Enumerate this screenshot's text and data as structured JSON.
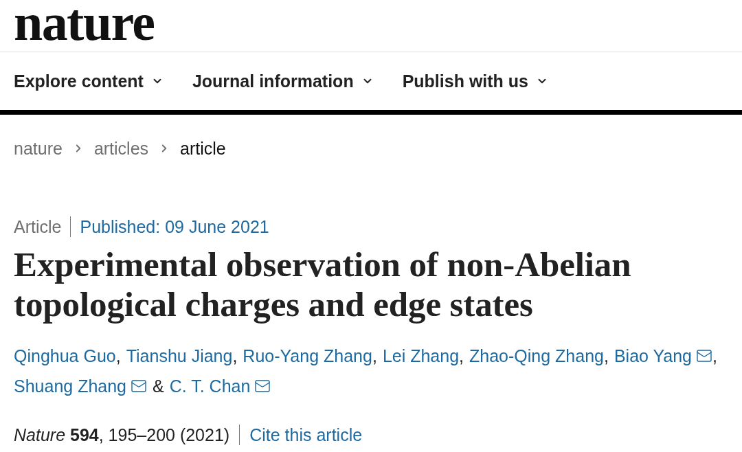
{
  "header": {
    "logo": "nature"
  },
  "nav": [
    {
      "label": "Explore content"
    },
    {
      "label": "Journal information"
    },
    {
      "label": "Publish with us"
    }
  ],
  "breadcrumbs": [
    {
      "label": "nature",
      "current": false
    },
    {
      "label": "articles",
      "current": false
    },
    {
      "label": "article",
      "current": true
    }
  ],
  "article": {
    "type": "Article",
    "published": "Published: 09 June 2021",
    "title": "Experimental observation of non-Abelian topological charges and edge states",
    "authors": [
      {
        "name": "Qinghua Guo",
        "email": false,
        "separator": ","
      },
      {
        "name": "Tianshu Jiang",
        "email": false,
        "separator": ","
      },
      {
        "name": "Ruo-Yang Zhang",
        "email": false,
        "separator": ","
      },
      {
        "name": "Lei Zhang",
        "email": false,
        "separator": ","
      },
      {
        "name": "Zhao-Qing Zhang",
        "email": false,
        "separator": ","
      },
      {
        "name": "Biao Yang",
        "email": true,
        "separator": ","
      },
      {
        "name": "Shuang Zhang",
        "email": true
      },
      {
        "conjunction": "&",
        "name": "C. T. Chan",
        "email": true
      }
    ],
    "citation": "*Nature* **594**, 195–200 (2021)",
    "cite_link": "Cite this article"
  }
}
